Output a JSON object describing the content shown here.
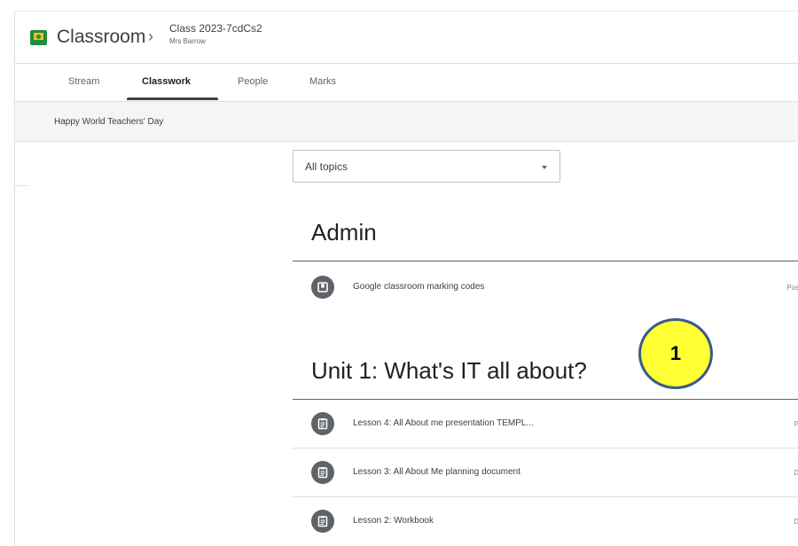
{
  "header": {
    "app_title": "Classroom",
    "breadcrumb_separator": "›",
    "class_name": "Class 2023-7cdCs2",
    "teacher": "Mrs Barrow"
  },
  "tabs": [
    {
      "label": "Stream"
    },
    {
      "label": "Classwork"
    },
    {
      "label": "People"
    },
    {
      "label": "Marks"
    }
  ],
  "active_tab": "Classwork",
  "announcement": "Happy World Teachers' Day",
  "topic_filter": {
    "selected": "All topics"
  },
  "sections": [
    {
      "title": "Admin",
      "items": [
        {
          "title": "Google classroom marking codes",
          "meta": "Pos",
          "icon": "material-icon"
        }
      ]
    },
    {
      "title": "Unit 1: What's IT all about?",
      "items": [
        {
          "title": "Lesson 4: All About me presentation TEMPL...",
          "meta": "P",
          "icon": "assignment-icon"
        },
        {
          "title": "Lesson 3: All About Me planning document",
          "meta": "D",
          "icon": "assignment-icon"
        },
        {
          "title": "Lesson 2: Workbook",
          "meta": "D",
          "icon": "assignment-icon"
        }
      ]
    }
  ],
  "callout_badge": "1",
  "colors": {
    "brand_green": "#1e8e3e",
    "brand_yellow": "#f6c026",
    "badge_fill": "#ffff33",
    "badge_border": "#3a5b86"
  }
}
